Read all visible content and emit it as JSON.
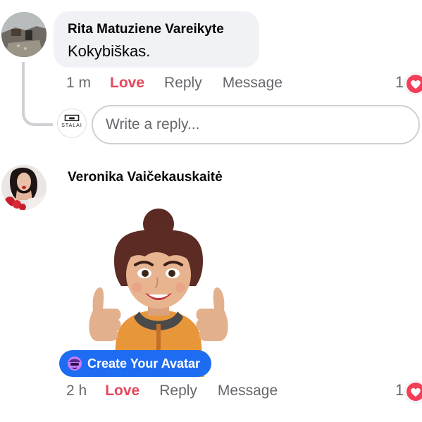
{
  "comments": [
    {
      "author": "Rita Matuziene Vareikyte",
      "text": "Kokybiškas.",
      "time": "1 m",
      "love_label": "Love",
      "reply_label": "Reply",
      "message_label": "Message",
      "reaction_count": "1",
      "reaction_icon": "heart-icon"
    },
    {
      "author": "Veronika Vaičekauskaitė",
      "time": "2 h",
      "love_label": "Love",
      "reply_label": "Reply",
      "message_label": "Message",
      "reaction_count": "1",
      "reaction_icon": "heart-icon",
      "sticker": "avatar-sticker-thumbs-up",
      "avatar_button_label": "Create Your Avatar"
    }
  ],
  "reply_box": {
    "placeholder": "Write a reply...",
    "avatar_logo_text": "STALAI"
  },
  "colors": {
    "love": "#e4485b",
    "action_gray": "#65676b",
    "bubble_bg": "#f0f2f5",
    "avatar_button_bg": "#1d6cf2",
    "heart": "#f33e58"
  }
}
